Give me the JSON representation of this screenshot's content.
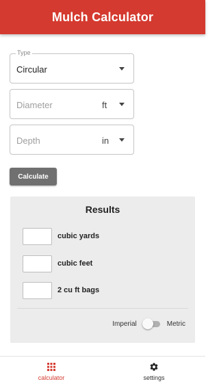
{
  "app": {
    "title": "Mulch Calculator"
  },
  "form": {
    "type": {
      "legend": "Type",
      "value": "Circular"
    },
    "diameter": {
      "placeholder": "Diameter",
      "unit": "ft"
    },
    "depth": {
      "placeholder": "Depth",
      "unit": "in"
    },
    "calculate_label": "Calculate"
  },
  "results": {
    "title": "Results",
    "rows": [
      {
        "label": "cubic yards",
        "value": ""
      },
      {
        "label": "cubic feet",
        "value": ""
      },
      {
        "label": "2 cu ft bags",
        "value": ""
      }
    ],
    "toggle": {
      "left_label": "Imperial",
      "right_label": "Metric",
      "selected": "Imperial"
    }
  },
  "nav": {
    "items": [
      {
        "label": "calculator",
        "icon": "grid-icon",
        "active": true
      },
      {
        "label": "settings",
        "icon": "gear-icon",
        "active": false
      }
    ]
  },
  "colors": {
    "accent": "#d43a2f",
    "button": "#707070",
    "panel": "#ececec"
  }
}
